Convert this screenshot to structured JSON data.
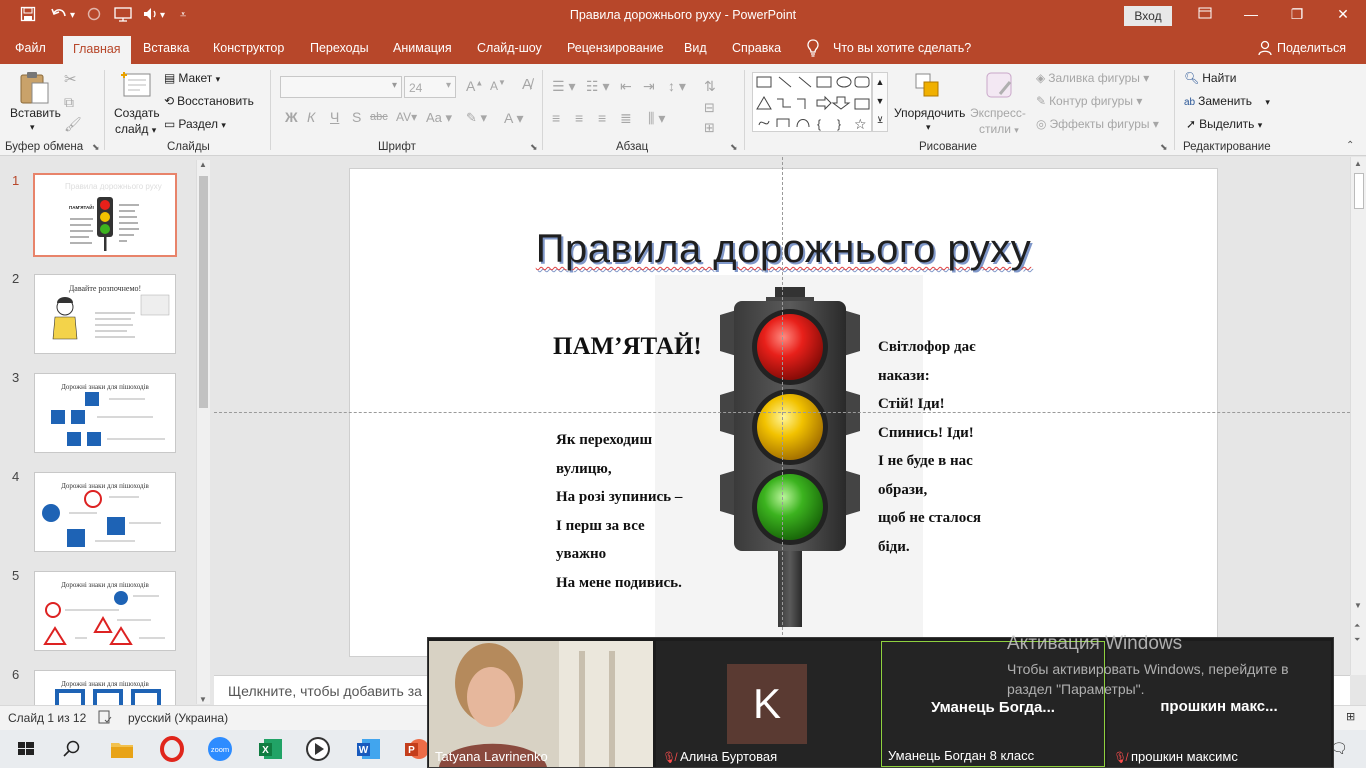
{
  "window": {
    "title": "Правила дорожнього руху  -  PowerPoint",
    "login_label": "Вход",
    "controls": [
      "minimize-icon",
      "restore-icon",
      "close-icon"
    ]
  },
  "quick_access": [
    "save-icon",
    "undo-icon",
    "redo-icon",
    "present-icon",
    "audio-icon",
    "customize-icon"
  ],
  "tabs": [
    {
      "label": "Файл"
    },
    {
      "label": "Главная",
      "active": true
    },
    {
      "label": "Вставка"
    },
    {
      "label": "Конструктор"
    },
    {
      "label": "Переходы"
    },
    {
      "label": "Анимация"
    },
    {
      "label": "Слайд-шоу"
    },
    {
      "label": "Рецензирование"
    },
    {
      "label": "Вид"
    },
    {
      "label": "Справка"
    },
    {
      "label": "Что вы хотите сделать?"
    },
    {
      "label": "Поделиться"
    }
  ],
  "ribbon": {
    "clipboard": {
      "paste": "Вставить",
      "group": "Буфер обмена"
    },
    "slides": {
      "new_slide_1": "Создать",
      "new_slide_2": "слайд",
      "layout": "Макет",
      "reset": "Восстановить",
      "section": "Раздел",
      "group": "Слайды"
    },
    "font": {
      "size": "24",
      "group": "Шрифт"
    },
    "paragraph": {
      "group": "Абзац"
    },
    "drawing": {
      "arrange": "Упорядочить",
      "quick_styles_1": "Экспресс-",
      "quick_styles_2": "стили",
      "fill": "Заливка фигуры",
      "outline": "Контур фигуры",
      "effects": "Эффекты фигуры",
      "group": "Рисование"
    },
    "editing": {
      "find": "Найти",
      "replace": "Заменить",
      "select": "Выделить",
      "group": "Редактирование"
    }
  },
  "thumbnails": [
    {
      "num": "1",
      "title": ""
    },
    {
      "num": "2",
      "title": "Давайте розпочнемо!"
    },
    {
      "num": "3",
      "title": "Дорожні знаки для пішоходів"
    },
    {
      "num": "4",
      "title": "Дорожні знаки для пішоходів"
    },
    {
      "num": "5",
      "title": "Дорожні знаки для пішоходів"
    },
    {
      "num": "6",
      "title": "Дорожні знаки для пішоходів"
    }
  ],
  "slide": {
    "title": "Правила дорожнього руху",
    "remember": "ПАМ’ЯТАЙ!",
    "poem_left": [
      "Як переходиш",
      "вулицю,",
      "На розі зупинись –",
      "І перш за все",
      "уважно",
      "На мене подивись."
    ],
    "poem_right": [
      "Світлофор дає",
      "накази:",
      "Стій! Іди!",
      "Спинись! Іди!",
      "І не буде в нас",
      "образи,",
      "щоб не сталося",
      "біди."
    ]
  },
  "notes": {
    "placeholder": "Щелкните, чтобы добавить за"
  },
  "status": {
    "slide_counter": "Слайд 1 из 12",
    "language": "русский (Украина)"
  },
  "zoom": {
    "participants": [
      {
        "name": "Tatyana Lavrinenko",
        "video": true,
        "muted": false
      },
      {
        "name": "Алина Буртовая",
        "initial": "K",
        "muted": true
      },
      {
        "name": "Уманець Богдан 8 класс",
        "display": "Уманець  Богда...",
        "muted": false
      },
      {
        "name": "прошкин максимс",
        "display": "прошкин  макс...",
        "muted": true
      }
    ]
  },
  "activation": {
    "title": "Активация Windows",
    "message": "Чтобы активировать Windows, перейдите в раздел \"Параметры\"."
  },
  "taskbar": [
    "windows-start-icon",
    "search-icon",
    "file-explorer-icon",
    "opera-icon",
    "zoom-icon",
    "excel-icon",
    "media-player-icon",
    "word-icon",
    "powerpoint-icon"
  ],
  "colors": {
    "accent": "#b7472a",
    "thumb_selected": "#e8836a",
    "red_light": "#e8201a",
    "yellow_light": "#f2c200",
    "green_light": "#3cb31f"
  }
}
